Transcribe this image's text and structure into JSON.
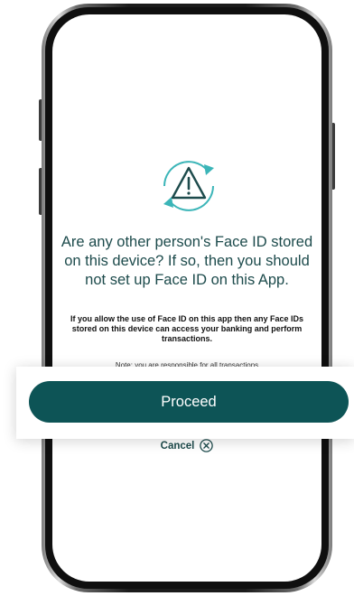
{
  "screen": {
    "heading": "Are any other person's Face ID stored on this device? If so, then you should not set up Face ID on this App.",
    "subtext": "If you allow the use of Face ID on this app then any Face IDs stored on this device can access your banking and perform transactions.",
    "note": "Note: you are responsible for all transactions",
    "cancel_label": "Cancel"
  },
  "proceed_label": "Proceed",
  "icons": {
    "warning": "warning-refresh-icon",
    "cancel": "close-circle-icon"
  },
  "colors": {
    "heading_text": "#1d4b4c",
    "button_bg": "#0d5456",
    "icon_accent": "#3bb5b8"
  }
}
